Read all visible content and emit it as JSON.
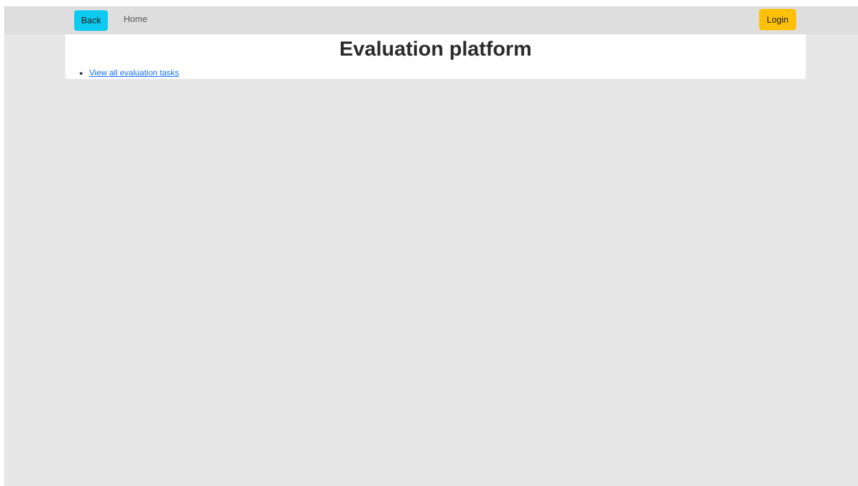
{
  "navbar": {
    "back_label": "Back",
    "home_label": "Home",
    "login_label": "Login"
  },
  "main": {
    "title": "Evaluation platform",
    "links": [
      {
        "label": "View all evaluation tasks"
      }
    ]
  },
  "colors": {
    "page_background": "#e7e7e7",
    "navbar_background": "#dedede",
    "back_button": "#0dcaf0",
    "login_button": "#ffc107",
    "link": "#0d6efd"
  }
}
